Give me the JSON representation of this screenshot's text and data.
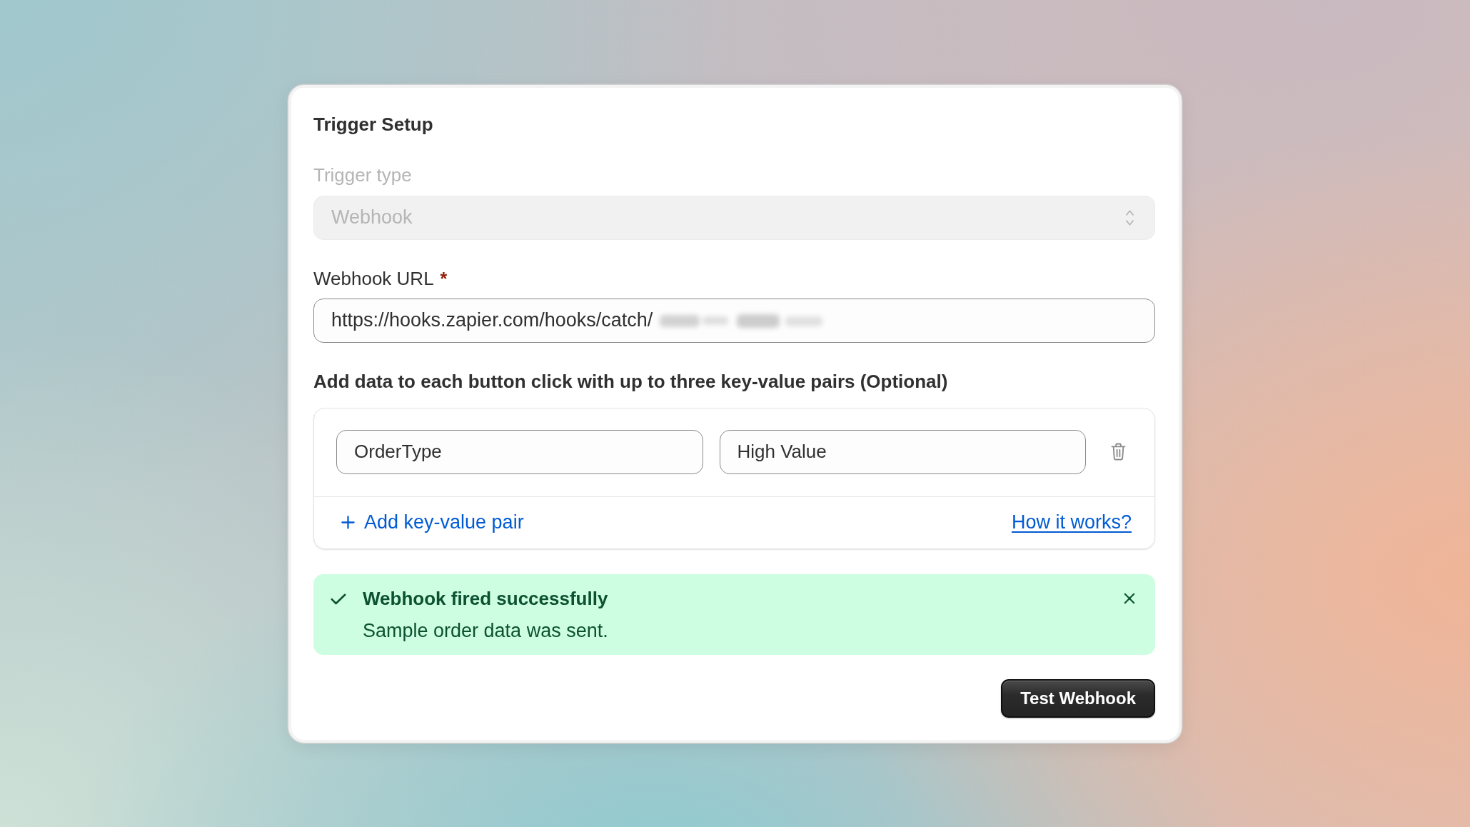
{
  "card": {
    "title": "Trigger Setup",
    "trigger_type": {
      "label": "Trigger type",
      "value": "Webhook",
      "disabled": true
    },
    "webhook_url": {
      "label": "Webhook URL",
      "required_mark": "*",
      "value": "https://hooks.zapier.com/hooks/catch/",
      "redacted": true
    },
    "key_values": {
      "label": "Add data to each button click with up to three key-value pairs (Optional)",
      "pairs": [
        {
          "key": "OrderType",
          "value": "High Value"
        }
      ],
      "add_link": "Add key-value pair",
      "help_link": "How it works?"
    },
    "alert": {
      "kind": "success",
      "title": "Webhook fired successfully",
      "message": "Sample order data was sent.",
      "dismissible": true
    },
    "button": "Test Webhook"
  }
}
